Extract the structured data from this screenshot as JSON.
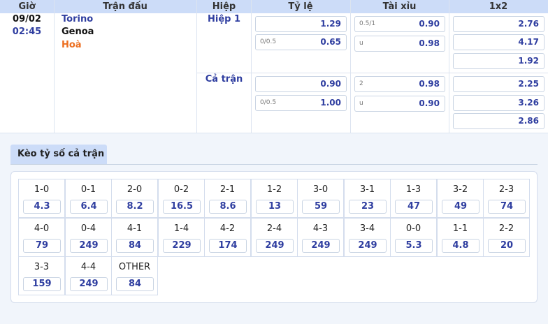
{
  "header": {
    "time": "Giờ",
    "match": "Trận đấu",
    "period": "Hiệp",
    "handicap": "Tỷ lệ",
    "overunder": "Tài xỉu",
    "x12": "1x2"
  },
  "match": {
    "date": "09/02",
    "time": "02:45",
    "home": "Torino",
    "away": "Genoa",
    "draw": "Hoà"
  },
  "periods": [
    {
      "label": "Hiệp 1",
      "handicap": [
        {
          "line": "",
          "odds": "1.29"
        },
        {
          "line": "0/0.5",
          "odds": "0.65"
        }
      ],
      "overunder": [
        {
          "line": "0.5/1",
          "odds": "0.90"
        },
        {
          "line": "u",
          "odds": "0.98"
        }
      ],
      "x12": [
        "2.76",
        "4.17",
        "1.92"
      ]
    },
    {
      "label": "Cả trận",
      "handicap": [
        {
          "line": "",
          "odds": "0.90"
        },
        {
          "line": "0/0.5",
          "odds": "1.00"
        }
      ],
      "overunder": [
        {
          "line": "2",
          "odds": "0.98"
        },
        {
          "line": "u",
          "odds": "0.90"
        }
      ],
      "x12": [
        "2.25",
        "3.26",
        "2.86"
      ]
    }
  ],
  "score_section": {
    "title": "Kèo tỷ số cả trận",
    "scores": [
      {
        "score": "1-0",
        "odds": "4.3"
      },
      {
        "score": "0-1",
        "odds": "6.4"
      },
      {
        "score": "2-0",
        "odds": "8.2"
      },
      {
        "score": "0-2",
        "odds": "16.5"
      },
      {
        "score": "2-1",
        "odds": "8.6"
      },
      {
        "score": "1-2",
        "odds": "13"
      },
      {
        "score": "3-0",
        "odds": "59"
      },
      {
        "score": "3-1",
        "odds": "23"
      },
      {
        "score": "1-3",
        "odds": "47"
      },
      {
        "score": "3-2",
        "odds": "49"
      },
      {
        "score": "2-3",
        "odds": "74"
      },
      {
        "score": "4-0",
        "odds": "79"
      },
      {
        "score": "0-4",
        "odds": "249"
      },
      {
        "score": "4-1",
        "odds": "84"
      },
      {
        "score": "1-4",
        "odds": "229"
      },
      {
        "score": "4-2",
        "odds": "174"
      },
      {
        "score": "2-4",
        "odds": "249"
      },
      {
        "score": "4-3",
        "odds": "249"
      },
      {
        "score": "3-4",
        "odds": "249"
      },
      {
        "score": "0-0",
        "odds": "5.3"
      },
      {
        "score": "1-1",
        "odds": "4.8"
      },
      {
        "score": "2-2",
        "odds": "20"
      },
      {
        "score": "3-3",
        "odds": "159"
      },
      {
        "score": "4-4",
        "odds": "249"
      },
      {
        "score": "OTHER",
        "odds": "84"
      }
    ]
  },
  "colors": {
    "header_bg": "#ccdcf8",
    "accent": "#2f3ea0",
    "draw": "#ec6e1f"
  }
}
